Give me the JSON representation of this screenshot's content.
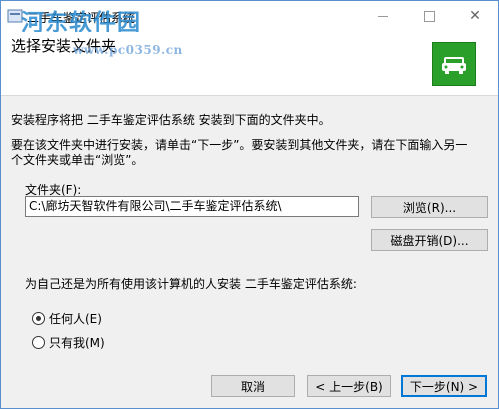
{
  "window": {
    "title": "二手车鉴定评估系统"
  },
  "watermark": {
    "logo": "河东软件园",
    "url": "www.pc0359.cn"
  },
  "header": {
    "title": "选择安装文件夹",
    "icon": "car-icon",
    "icon_color": "#2aa02a"
  },
  "body": {
    "intro": "安装程序将把 二手车鉴定评估系统 安装到下面的文件夹中。",
    "instructions_line1": "要在该文件夹中进行安装，请单击“下一步”。要安装到其他文件夹，请在下面输入另一",
    "instructions_line2": "个文件夹或单击“浏览”。",
    "folder_label": "文件夹(F):",
    "folder_value": "C:\\廊坊天智软件有限公司\\二手车鉴定评估系统\\",
    "browse_button": "浏览(R)...",
    "disk_cost_button": "磁盘开销(D)...",
    "scope_prompt": "为自己还是为所有使用该计算机的人安装 二手车鉴定评估系统:",
    "options": [
      {
        "label": "任何人(E)",
        "selected": true
      },
      {
        "label": "只有我(M)",
        "selected": false
      }
    ]
  },
  "footer": {
    "cancel": "取消",
    "back": "< 上一步(B)",
    "next": "下一步(N) >"
  }
}
